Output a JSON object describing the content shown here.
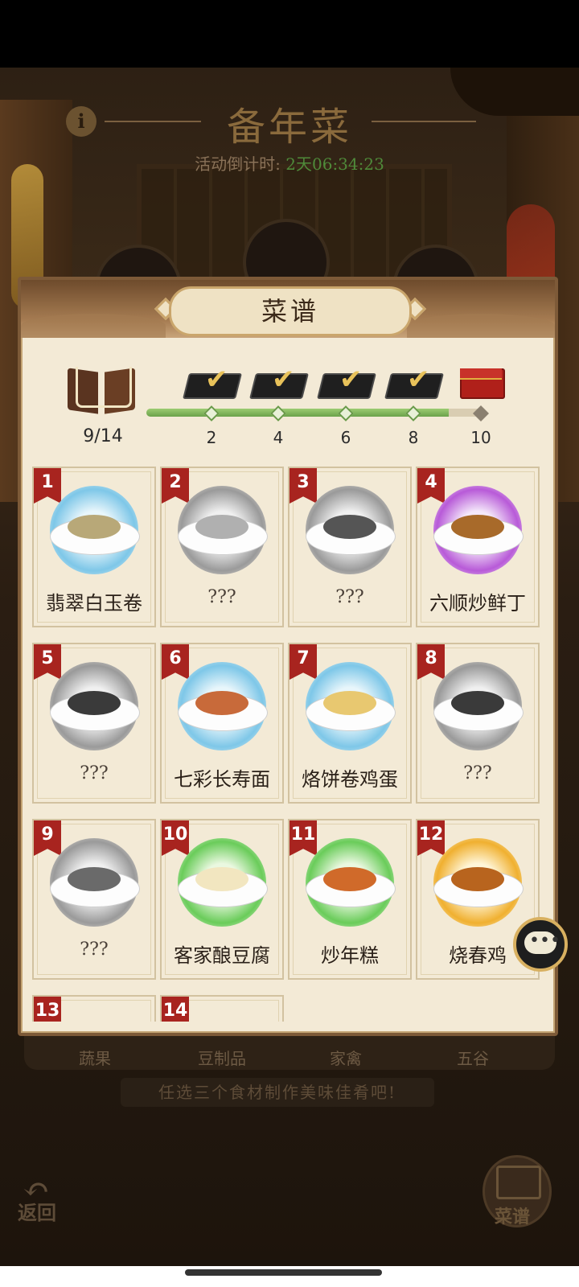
{
  "header": {
    "title": "备年菜",
    "countdown_label": "活动倒计时:",
    "countdown_value": "2天06:34:23"
  },
  "panel": {
    "title": "菜谱",
    "collected": "9/14",
    "progress": {
      "fraction": 0.9
    },
    "milestones": [
      "2",
      "4",
      "6",
      "8",
      "10"
    ],
    "milestone_states": [
      "claimed",
      "claimed",
      "claimed",
      "claimed",
      "locked"
    ]
  },
  "recipes": [
    {
      "num": "1",
      "name": "翡翠白玉卷",
      "halo": "blue",
      "food": "#b8a878",
      "unlocked": true
    },
    {
      "num": "2",
      "name": "???",
      "halo": "gray",
      "food": "#b0b0b0",
      "unlocked": false
    },
    {
      "num": "3",
      "name": "???",
      "halo": "gray",
      "food": "#555555",
      "unlocked": false
    },
    {
      "num": "4",
      "name": "六顺炒鲜丁",
      "halo": "purple",
      "food": "#a86a2a",
      "unlocked": true
    },
    {
      "num": "5",
      "name": "???",
      "halo": "gray",
      "food": "#3a3a3a",
      "unlocked": false
    },
    {
      "num": "6",
      "name": "七彩长寿面",
      "halo": "blue",
      "food": "#c86a3a",
      "unlocked": true
    },
    {
      "num": "7",
      "name": "烙饼卷鸡蛋",
      "halo": "blue",
      "food": "#e8c870",
      "unlocked": true
    },
    {
      "num": "8",
      "name": "???",
      "halo": "gray",
      "food": "#3a3a3a",
      "unlocked": false
    },
    {
      "num": "9",
      "name": "???",
      "halo": "gray",
      "food": "#6a6a6a",
      "unlocked": false
    },
    {
      "num": "10",
      "name": "客家酿豆腐",
      "halo": "green",
      "food": "#f2e6c0",
      "unlocked": true
    },
    {
      "num": "11",
      "name": "炒年糕",
      "halo": "green",
      "food": "#d06a2a",
      "unlocked": true
    },
    {
      "num": "12",
      "name": "烧春鸡",
      "halo": "gold",
      "food": "#b8641e",
      "unlocked": true
    },
    {
      "num": "13",
      "name": "",
      "halo": "",
      "food": "",
      "unlocked": false
    },
    {
      "num": "14",
      "name": "",
      "halo": "",
      "food": "",
      "unlocked": false
    }
  ],
  "categories": [
    "蔬果",
    "豆制品",
    "家禽",
    "五谷"
  ],
  "hint": "任选三个食材制作美味佳肴吧!",
  "back_label": "返回",
  "recipe_button_label": "菜谱",
  "icons": {
    "info": "info-icon",
    "book": "recipe-book-icon",
    "reward": "reward-chest-icon",
    "chat": "chat-bubble-icon",
    "back": "back-arrow-icon"
  },
  "info_glyph": "i",
  "chat_glyph": "•••"
}
